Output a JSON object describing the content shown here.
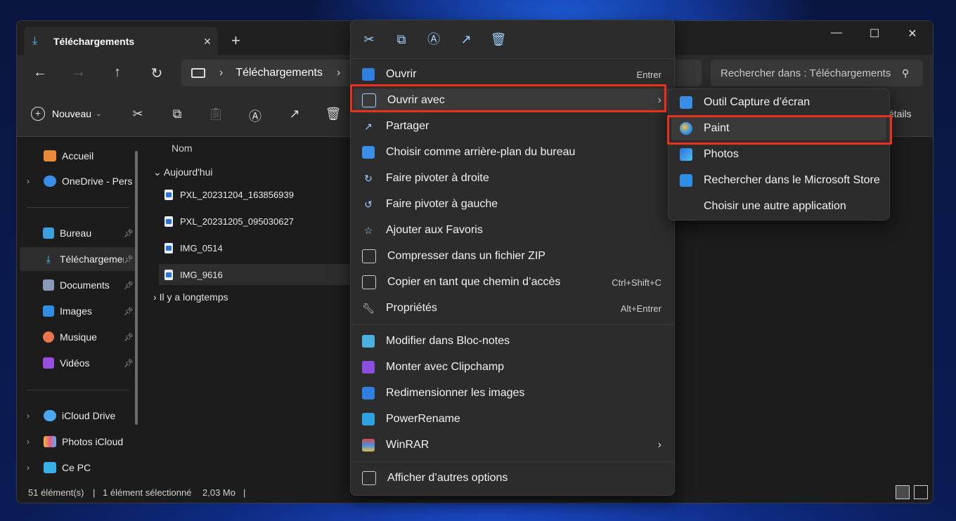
{
  "window": {
    "tab_title": "Téléchargements",
    "new_tab": "+",
    "controls": {
      "minimize": "—",
      "maximize": "☐",
      "close": "✕"
    }
  },
  "address": {
    "crumb": "Téléchargements",
    "search_placeholder": "Rechercher dans : Téléchargements"
  },
  "toolbar": {
    "new_label": "Nouveau",
    "details_label": "étails"
  },
  "sidebar": {
    "items": [
      {
        "label": "Accueil",
        "icon": "home-icon"
      },
      {
        "label": "OneDrive - Personnel",
        "icon": "cloud-icon"
      },
      {
        "label": "Bureau",
        "icon": "desktop-icon"
      },
      {
        "label": "Téléchargements",
        "icon": "download-icon"
      },
      {
        "label": "Documents",
        "icon": "document-icon"
      },
      {
        "label": "Images",
        "icon": "image-icon"
      },
      {
        "label": "Musique",
        "icon": "music-icon"
      },
      {
        "label": "Vidéos",
        "icon": "video-icon"
      },
      {
        "label": "iCloud Drive",
        "icon": "icloud-icon"
      },
      {
        "label": "Photos iCloud",
        "icon": "photos-icloud-icon"
      },
      {
        "label": "Ce PC",
        "icon": "pc-icon"
      }
    ]
  },
  "files": {
    "column_name": "Nom",
    "group_today": "Aujourd'hui",
    "group_old": "Il y a longtemps",
    "items": [
      "PXL_20231204_163856939",
      "PXL_20231205_095030627",
      "IMG_0514",
      "IMG_9616"
    ]
  },
  "status": {
    "count": "51 élément(s)",
    "selected": "1 élément sélectionné",
    "size": "2,03 Mo",
    "sep": "|"
  },
  "context_menu": {
    "quick_actions": [
      "cut-icon",
      "copy-icon",
      "rename-icon",
      "share-icon",
      "delete-icon"
    ],
    "items": [
      {
        "label": "Ouvrir",
        "shortcut": "Entrer"
      },
      {
        "label": "Ouvrir avec",
        "shortcut": ""
      },
      {
        "label": "Partager",
        "shortcut": ""
      },
      {
        "label": "Choisir comme arrière-plan du bureau",
        "shortcut": ""
      },
      {
        "label": "Faire pivoter à droite",
        "shortcut": ""
      },
      {
        "label": "Faire pivoter à gauche",
        "shortcut": ""
      },
      {
        "label": "Ajouter aux Favoris",
        "shortcut": ""
      },
      {
        "label": "Compresser dans un fichier ZIP",
        "shortcut": ""
      },
      {
        "label": "Copier en tant que chemin d’accès",
        "shortcut": "Ctrl+Shift+C"
      },
      {
        "label": "Propriétés",
        "shortcut": "Alt+Entrer"
      },
      {
        "label": "Modifier dans Bloc-notes",
        "shortcut": ""
      },
      {
        "label": "Monter avec Clipchamp",
        "shortcut": ""
      },
      {
        "label": "Redimensionner les images",
        "shortcut": ""
      },
      {
        "label": "PowerRename",
        "shortcut": ""
      },
      {
        "label": "WinRAR",
        "shortcut": ""
      },
      {
        "label": "Afficher d’autres options",
        "shortcut": ""
      }
    ],
    "arrow": "›"
  },
  "submenu": {
    "items": [
      "Outil Capture d’écran",
      "Paint",
      "Photos",
      "Rechercher dans le Microsoft Store",
      "Choisir une autre application"
    ]
  },
  "colors": {
    "highlight_box": "#e8321c",
    "accent": "#4cc2ff"
  }
}
